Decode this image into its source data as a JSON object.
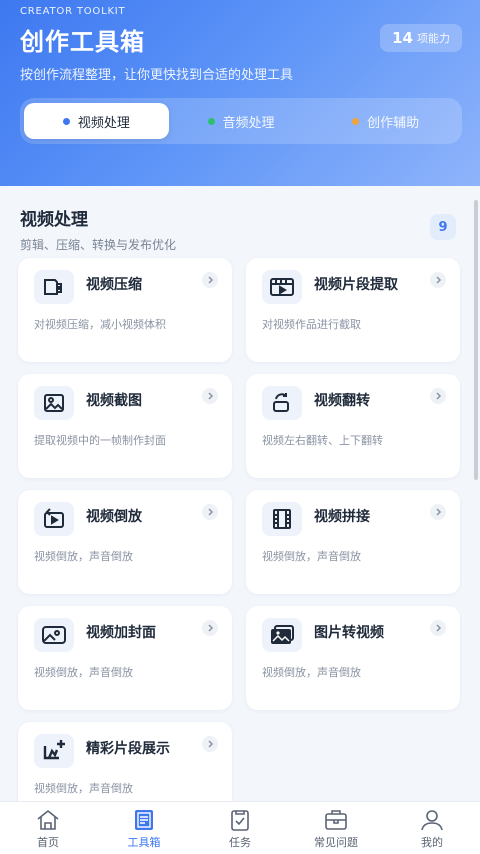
{
  "header": {
    "brand": "CREATOR TOOLKIT",
    "title": "创作工具箱",
    "subtitle": "按创作流程整理，让你更快找到合适的处理工具",
    "count": "14",
    "count_unit": "项能力"
  },
  "tabs": [
    {
      "label": "视频处理",
      "color": "#3e78f0"
    },
    {
      "label": "音频处理",
      "color": "#2fbf71"
    },
    {
      "label": "创作辅助",
      "color": "#f2a43a"
    }
  ],
  "section": {
    "title": "视频处理",
    "subtitle": "剪辑、压缩、转换与发布优化",
    "count": "9"
  },
  "tools": [
    {
      "title": "视频压缩",
      "desc": "对视频压缩，减小视频体积",
      "icon": "compress-icon"
    },
    {
      "title": "视频片段提取",
      "desc": "对视频作品进行截取",
      "icon": "clip-icon"
    },
    {
      "title": "视频截图",
      "desc": "提取视频中的一帧制作封面",
      "icon": "screenshot-icon"
    },
    {
      "title": "视频翻转",
      "desc": "视频左右翻转、上下翻转",
      "icon": "flip-icon"
    },
    {
      "title": "视频倒放",
      "desc": "视频倒放，声音倒放",
      "icon": "reverse-icon"
    },
    {
      "title": "视频拼接",
      "desc": "视频倒放，声音倒放",
      "icon": "film-icon"
    },
    {
      "title": "视频加封面",
      "desc": "视频倒放，声音倒放",
      "icon": "cover-icon"
    },
    {
      "title": "图片转视频",
      "desc": "视频倒放，声音倒放",
      "icon": "image-to-video-icon"
    },
    {
      "title": "精彩片段展示",
      "desc": "视频倒放，声音倒放",
      "icon": "highlight-icon"
    }
  ],
  "nav": [
    {
      "label": "首页",
      "icon": "home-icon"
    },
    {
      "label": "工具箱",
      "icon": "toolbox-icon"
    },
    {
      "label": "任务",
      "icon": "task-icon"
    },
    {
      "label": "常见问题",
      "icon": "faq-icon"
    },
    {
      "label": "我的",
      "icon": "profile-icon"
    }
  ],
  "colors": {
    "accent": "#3e78f0",
    "icon_stroke": "#1f2a3a"
  }
}
